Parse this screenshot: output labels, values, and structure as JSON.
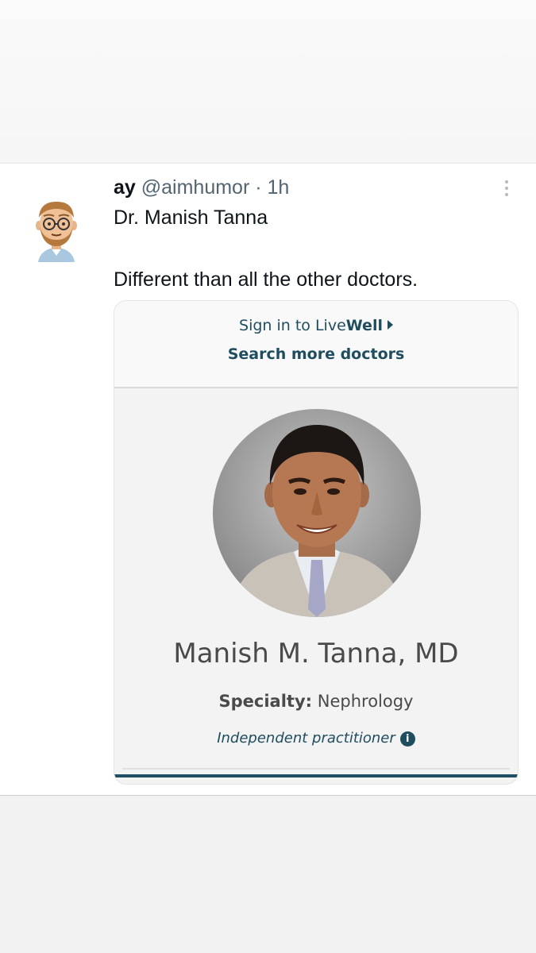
{
  "tweet": {
    "display_name": "ay",
    "handle": "@aimhumor",
    "separator": "·",
    "time": "1h",
    "line1": "Dr. Manish Tanna",
    "line2": "Different than all the other doctors."
  },
  "card": {
    "signin_prefix": "Sign in to Live",
    "signin_brand": "Well",
    "search_link": "Search more doctors",
    "doctor_name": "Manish M. Tanna, MD",
    "specialty_label": "Specialty:",
    "specialty_value": "Nephrology",
    "practitioner_type": "Independent practitioner"
  },
  "icons": {
    "more": "more-vertical-icon",
    "info": "info-icon",
    "caret": "caret-right-icon"
  },
  "colors": {
    "link_teal": "#1f4d5e",
    "name_gray": "#4a4a4a",
    "meta_gray": "#536471"
  }
}
